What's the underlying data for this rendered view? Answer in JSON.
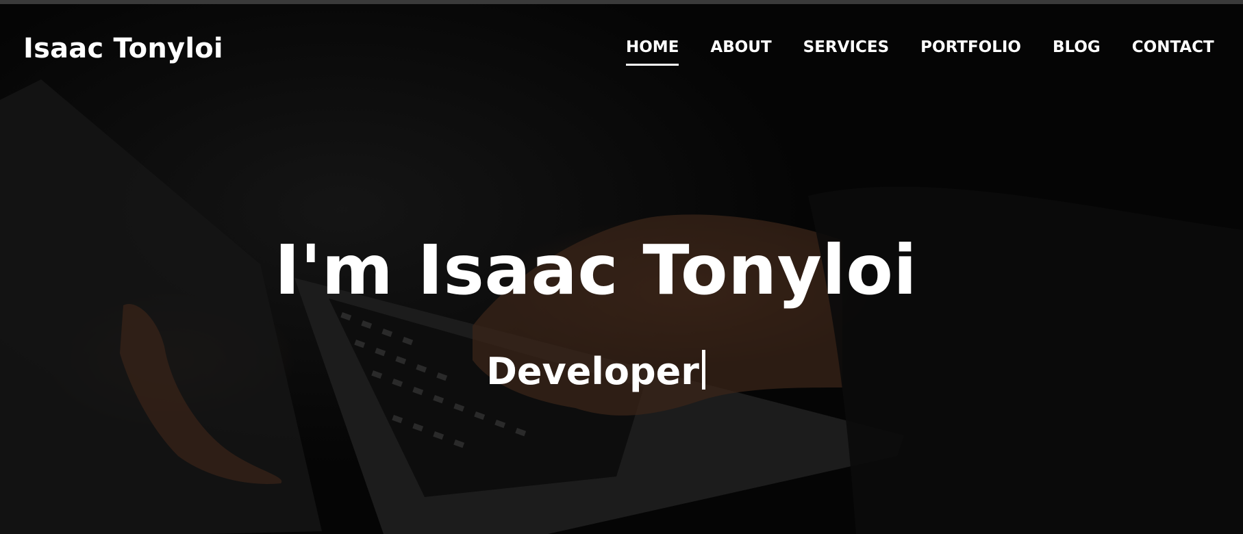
{
  "header": {
    "logo": "Isaac Tonyloi",
    "nav": [
      {
        "label": "HOME",
        "active": true
      },
      {
        "label": "ABOUT",
        "active": false
      },
      {
        "label": "SERVICES",
        "active": false
      },
      {
        "label": "PORTFOLIO",
        "active": false
      },
      {
        "label": "BLOG",
        "active": false
      },
      {
        "label": "CONTACT",
        "active": false
      }
    ]
  },
  "hero": {
    "title": "I'm Isaac Tonyloi",
    "typed_text": "Developer",
    "background_image": "laptop-typing-photo"
  },
  "colors": {
    "text": "#ffffff",
    "background": "#050505"
  }
}
